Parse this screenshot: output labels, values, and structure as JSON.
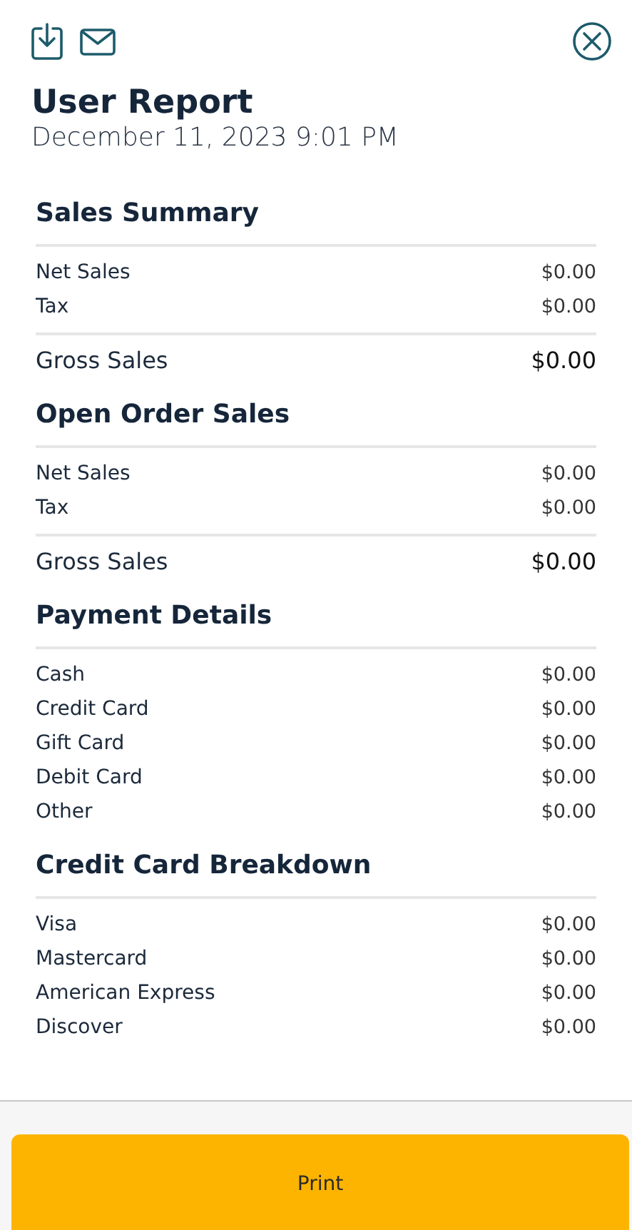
{
  "header": {
    "title": "User Report",
    "date": "December 11, 2023 9:01 PM"
  },
  "sections": [
    {
      "title": "Sales Summary",
      "rows": [
        {
          "kind": "item",
          "label": "Net Sales",
          "value": "$0.00"
        },
        {
          "kind": "item",
          "label": "Tax",
          "value": "$0.00"
        },
        {
          "kind": "total",
          "label": "Gross Sales",
          "value": "$0.00"
        }
      ]
    },
    {
      "title": "Open Order Sales",
      "rows": [
        {
          "kind": "item",
          "label": "Net Sales",
          "value": "$0.00"
        },
        {
          "kind": "item",
          "label": "Tax",
          "value": "$0.00"
        },
        {
          "kind": "total",
          "label": "Gross Sales",
          "value": "$0.00"
        }
      ]
    },
    {
      "title": "Payment Details",
      "rows": [
        {
          "kind": "item",
          "label": "Cash",
          "value": "$0.00"
        },
        {
          "kind": "item",
          "label": "Credit Card",
          "value": "$0.00"
        },
        {
          "kind": "item",
          "label": "Gift Card",
          "value": "$0.00"
        },
        {
          "kind": "item",
          "label": "Debit Card",
          "value": "$0.00"
        },
        {
          "kind": "item",
          "label": "Other",
          "value": "$0.00"
        }
      ]
    },
    {
      "title": "Credit Card Breakdown",
      "rows": [
        {
          "kind": "item",
          "label": "Visa",
          "value": "$0.00"
        },
        {
          "kind": "item",
          "label": "Mastercard",
          "value": "$0.00"
        },
        {
          "kind": "item",
          "label": "American Express",
          "value": "$0.00"
        },
        {
          "kind": "item",
          "label": "Discover",
          "value": "$0.00"
        }
      ]
    }
  ],
  "footer": {
    "button": "Print"
  }
}
